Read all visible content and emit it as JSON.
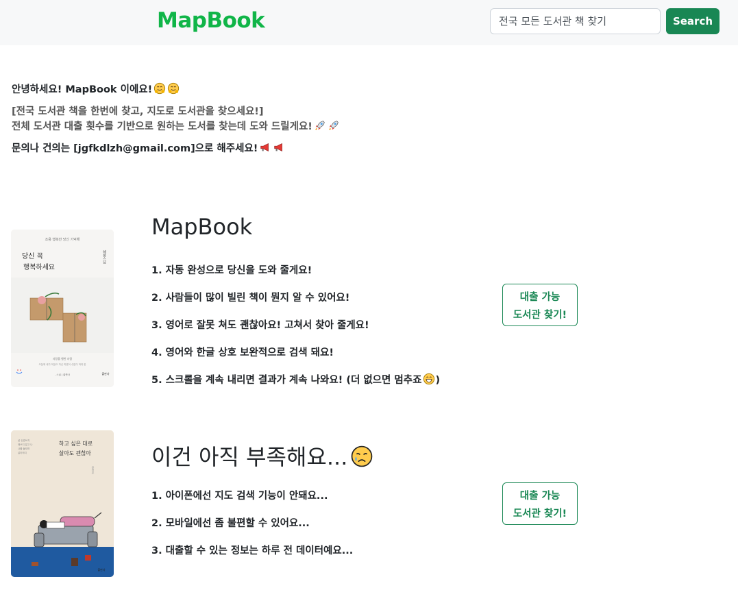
{
  "header": {
    "brand": "MapBook",
    "search_placeholder": "전국 모든 도서관 책 찾기",
    "search_label": "Search"
  },
  "intro": {
    "greeting": "안녕하세요! MapBook 이에요!",
    "desc_line1": "[전국 도서관 책을 한번에 찾고, 지도로 도서관을 찾으세요!]",
    "desc_line2": "전체 도서관 대출 횟수를 기반으로 원하는 도서를 찾는데 도와 드릴게요!",
    "contact": "문의나 건의는 [jgfkdlzh@gmail.com]으로 해주세요!"
  },
  "features": [
    {
      "title": "MapBook",
      "items": [
        "1. 자동 완성으로 당신을 도와 줄게요!",
        "2. 사람들이 많이 빌린 책이 뭔지 알 수 있어요!",
        "3. 영어로 잘못 쳐도 괜찮아요! 고쳐서 찾아 줄게요!",
        "4. 영어와 한글 상호 보완적으로 검색 돼요!",
        "5. 스크롤을 계속 내리면 결과가 계속 나와요! (더 없으면 멈추죠",
        ")"
      ],
      "button_line1": "대출 가능",
      "button_line2": "도서관 찾기!",
      "book": {
        "top_line": "조용 행복한 당신 기억해",
        "title1": "당신 꼭",
        "title2": "행복하세요",
        "side": "해봉스님",
        "sub1": "사랑을 행한 사람",
        "sub2": "오늘에 내가 되었으 자신 하였어 수없이 하게 한",
        "author": "- 스님 | 출판사",
        "pub": "출판사"
      }
    },
    {
      "title": "이건 아직 부족해요...",
      "items": [
        "1. 아이폰에선 지도 검색 기능이 안돼요...",
        "2. 모바일에선 좀 불편할 수 있어요...",
        "3. 대출할 수 있는 정보는 하루 전 데이터예요..."
      ],
      "button_line1": "대출 가능",
      "button_line2": "도서관 찾기!",
      "book": {
        "title1": "하고 싶은 대로",
        "title2": "살아도 괜찮아",
        "side1": "윤정은",
        "side_lines": [
          "남 신경쓰지",
          "애쓰지 말고 나",
          "나를 돌보며",
          "살아야지"
        ],
        "pub": "출판사"
      }
    }
  ],
  "colors": {
    "brand": "#10b548",
    "primary": "#198754",
    "navbar_bg": "#f7f8f9"
  }
}
